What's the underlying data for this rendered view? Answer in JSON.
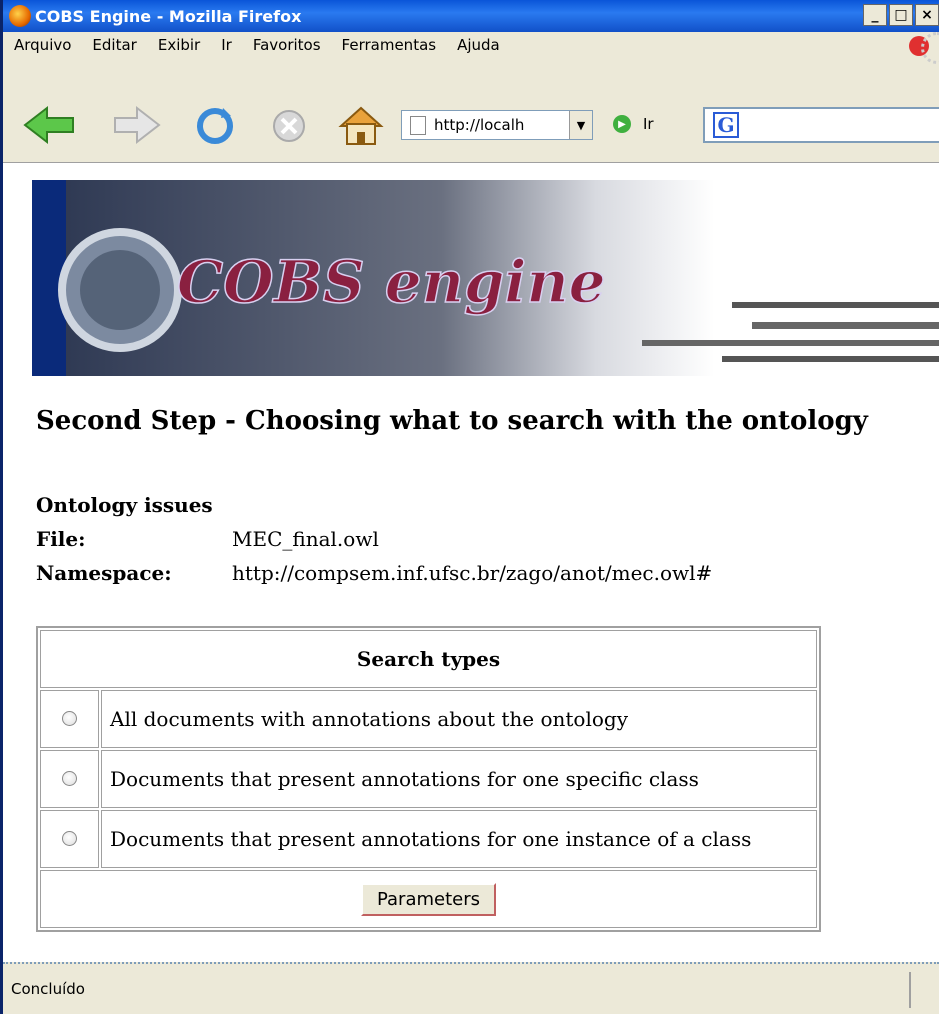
{
  "window": {
    "title": "COBS Engine - Mozilla Firefox",
    "min": "_",
    "max": "□",
    "close": "×"
  },
  "menu": [
    "Arquivo",
    "Editar",
    "Exibir",
    "Ir",
    "Favoritos",
    "Ferramentas",
    "Ajuda"
  ],
  "toolbar": {
    "url": "http://localh",
    "go_label": "Ir",
    "search_logo": "G"
  },
  "banner": {
    "logo_text": "COBS engine"
  },
  "page": {
    "heading": "Second Step - Choosing what to search with the ontology",
    "ontology_heading": "Ontology issues",
    "file_label": "File:",
    "file_value": "MEC_final.owl",
    "namespace_label": "Namespace:",
    "namespace_value": "http://compsem.inf.ufsc.br/zago/anot/mec.owl#",
    "table_header": "Search types",
    "options": [
      "All documents with annotations about the ontology",
      "Documents that present annotations for one specific class",
      "Documents that present annotations for one instance of a class"
    ],
    "button": "Parameters"
  },
  "status": {
    "text": "Concluído"
  }
}
